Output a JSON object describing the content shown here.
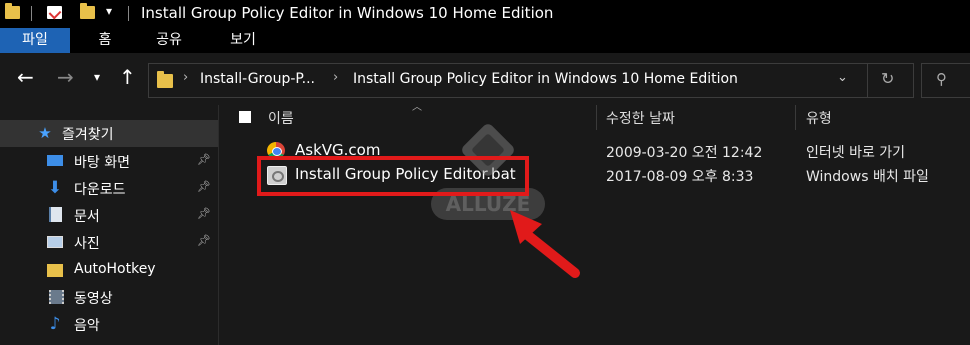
{
  "window": {
    "title": "Install Group Policy Editor in Windows 10 Home Edition"
  },
  "ribbon": {
    "tabs": [
      "파일",
      "홈",
      "공유",
      "보기"
    ]
  },
  "address": {
    "crumbs": [
      "Install-Group-P...",
      "Install Group Policy Editor in Windows 10 Home Edition"
    ]
  },
  "sidebar": {
    "items": [
      {
        "label": "즐겨찾기",
        "icon": "star-icon",
        "pinned": false
      },
      {
        "label": "바탕 화면",
        "icon": "desktop-icon",
        "pinned": true
      },
      {
        "label": "다운로드",
        "icon": "download-icon",
        "pinned": true
      },
      {
        "label": "문서",
        "icon": "documents-icon",
        "pinned": true
      },
      {
        "label": "사진",
        "icon": "pictures-icon",
        "pinned": true
      },
      {
        "label": "AutoHotkey",
        "icon": "folder-icon",
        "pinned": false
      },
      {
        "label": "동영상",
        "icon": "videos-icon",
        "pinned": false
      },
      {
        "label": "음악",
        "icon": "music-icon",
        "pinned": false
      }
    ]
  },
  "columns": {
    "name": "이름",
    "modified": "수정한 날짜",
    "type": "유형"
  },
  "files": [
    {
      "name": "AskVG.com",
      "modified": "2009-03-20 오전 12:42",
      "type": "인터넷 바로 가기",
      "icon": "chrome-shortcut-icon"
    },
    {
      "name": "Install Group Policy Editor.bat",
      "modified": "2017-08-09 오후 8:33",
      "type": "Windows 배치 파일",
      "icon": "batch-file-icon"
    }
  ],
  "watermark": {
    "text": "ALLUZE"
  },
  "colors": {
    "accent": "#1e63b4",
    "highlight": "#e11a1a",
    "folder": "#e8c04a"
  }
}
